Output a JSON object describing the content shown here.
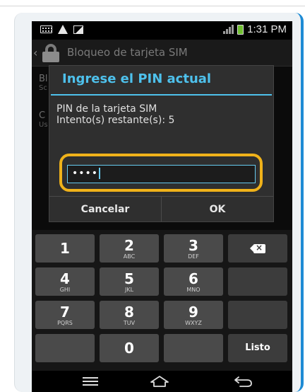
{
  "status_bar": {
    "time": "1:31 PM"
  },
  "action_bar": {
    "title": "Bloqueo de tarjeta SIM"
  },
  "background_list": [
    {
      "label": "Bl",
      "sub": "Sc"
    },
    {
      "label": "C",
      "sub": "Us"
    }
  ],
  "dialog": {
    "title": "Ingrese el PIN actual",
    "message_line1": "PIN de la tarjeta SIM",
    "message_line2": "Intento(s) restante(s): 5",
    "pin_value": "••••",
    "cancel_label": "Cancelar",
    "ok_label": "OK"
  },
  "keypad": {
    "keys": [
      {
        "num": "1",
        "letters": ""
      },
      {
        "num": "2",
        "letters": "ABC"
      },
      {
        "num": "3",
        "letters": "DEF"
      },
      {
        "num": "4",
        "letters": "GHI"
      },
      {
        "num": "5",
        "letters": "JKL"
      },
      {
        "num": "6",
        "letters": "MNO"
      },
      {
        "num": "7",
        "letters": "PQRS"
      },
      {
        "num": "8",
        "letters": "TUV"
      },
      {
        "num": "9",
        "letters": "WXYZ"
      },
      {
        "num": "0",
        "letters": ""
      }
    ],
    "done_label": "Listo"
  },
  "colors": {
    "accent": "#4ec1ec",
    "highlight": "#f0b21a",
    "frame_border": "#1e8bd4"
  }
}
